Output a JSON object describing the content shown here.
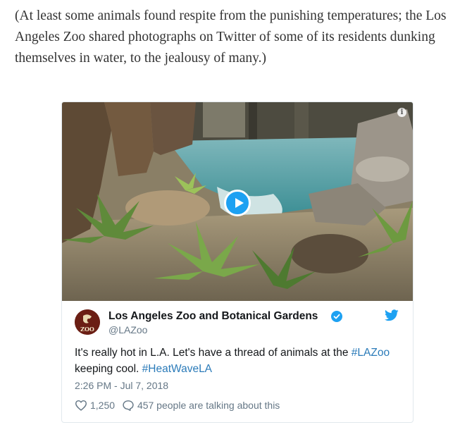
{
  "article": {
    "paragraph": "(At least some animals found respite from the punishing temperatures; the Los Angeles Zoo shared photographs on Twitter of some of its residents dunking themselves in water, to the jealousy of many.)"
  },
  "tweet": {
    "display_name": "Los Angeles Zoo and Botanical Gardens",
    "handle": "@LAZoo",
    "avatar_text": "ZOO",
    "text_part1": "It's really hot in L.A. Let's have a thread of animals at the ",
    "hashtag1": "#LAZoo",
    "text_part2": " keeping cool. ",
    "hashtag2": "#HeatWaveLA",
    "timestamp": "2:26 PM - Jul 7, 2018",
    "likes": "1,250",
    "conversation": "457 people are talking about this",
    "info_icon_text": "i"
  },
  "icons": {
    "info": "info-icon",
    "play": "play-icon",
    "verified": "verified-badge-icon",
    "bird": "twitter-bird-icon",
    "heart": "heart-icon",
    "comment": "comment-bubble-icon"
  },
  "colors": {
    "twitter_blue": "#1da1f2",
    "link_blue": "#2b7bb9",
    "muted_gray": "#657786",
    "text_dark": "#14171a",
    "article_text": "#333333",
    "zoo_brand": "#6b1e14"
  }
}
